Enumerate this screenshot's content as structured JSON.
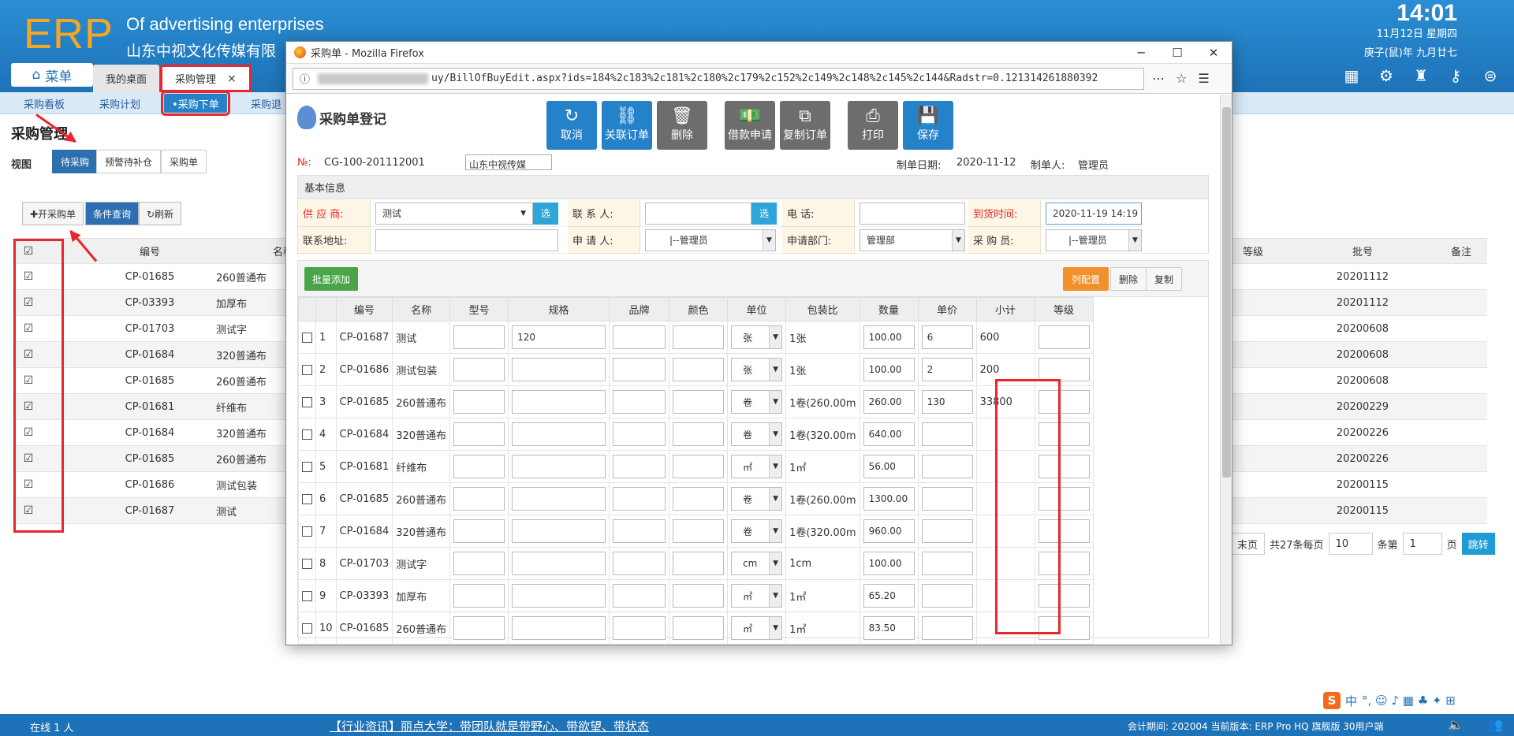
{
  "header": {
    "logo": "ERP",
    "app_en": "Of advertising enterprises",
    "app_cn": "山东中视文化传媒有限",
    "clock": "14:01",
    "date1": "11月12日 星期四",
    "date2": "庚子(鼠)年 九月廿七",
    "menu_label": "菜单",
    "tabs": [
      {
        "label": "我的桌面"
      },
      {
        "label": "采购管理",
        "close": "×"
      }
    ],
    "icons": [
      "grid-icon",
      "gear-icon",
      "shirt-icon",
      "key-icon",
      "collapse-icon"
    ]
  },
  "subnav": {
    "items": [
      "采购看板",
      "采购计划",
      "•采购下单",
      "采购退"
    ]
  },
  "bg": {
    "title": "采购管理",
    "view_label": "视图",
    "views": [
      "待采购",
      "预警待补仓",
      "采购单"
    ],
    "toolbar": [
      "✚开采购单",
      "条件查询",
      "↻刷新"
    ],
    "grid_headers": {
      "code": "编号",
      "name": "名称",
      "level": "等级",
      "batch": "批号",
      "remark": "备注"
    },
    "rows": [
      {
        "code": "CP-01685",
        "name": "260普通布",
        "batch": "20201112"
      },
      {
        "code": "CP-03393",
        "name": "加厚布",
        "batch": "20201112"
      },
      {
        "code": "CP-01703",
        "name": "测试字",
        "batch": "20200608"
      },
      {
        "code": "CP-01684",
        "name": "320普通布",
        "batch": "20200608"
      },
      {
        "code": "CP-01685",
        "name": "260普通布",
        "batch": "20200608"
      },
      {
        "code": "CP-01681",
        "name": "纤维布",
        "batch": "20200229"
      },
      {
        "code": "CP-01684",
        "name": "320普通布",
        "batch": "20200226"
      },
      {
        "code": "CP-01685",
        "name": "260普通布",
        "batch": "20200226"
      },
      {
        "code": "CP-01686",
        "name": "测试包装",
        "batch": "20200115"
      },
      {
        "code": "CP-01687",
        "name": "测试",
        "batch": "20200115"
      }
    ],
    "pager": {
      "last": "末页",
      "total": "共27条每页",
      "per_page": "10",
      "per_unit": "条第",
      "page": "1",
      "page_unit": "页",
      "go": "跳转"
    }
  },
  "statusbar": {
    "online": "在线  1  人",
    "news": "【行业资讯】丽点大学：带团队就是带野心、带欲望、带状态",
    "version": "会计期间: 202004 当前版本: ERP Pro HQ 旗舰版 30用户端"
  },
  "ime": {
    "label": "中",
    "glyphs": "°, ☺ ♪ ▦ ♣ ✦ ⊞"
  },
  "firefox": {
    "title": "采购单 - Mozilla Firefox",
    "url": "uy/BillOfBuyEdit.aspx?ids=184%2c183%2c181%2c180%2c179%2c152%2c149%2c148%2c145%2c144&Radstr=0.121314261880392"
  },
  "form": {
    "title": "采购单登记",
    "buttons": [
      {
        "label": "取消",
        "icon": "↻"
      },
      {
        "label": "关联订单",
        "icon": "⛓"
      },
      {
        "label": "删除",
        "icon": "🗑"
      },
      {
        "label": "借款申请",
        "icon": "💵"
      },
      {
        "label": "复制订单",
        "icon": "⧉"
      },
      {
        "label": "打印",
        "icon": "⎙"
      },
      {
        "label": "保存",
        "icon": "💾"
      }
    ],
    "no_label": "№:",
    "no_value": "CG-100-201112001",
    "company": "山东中视传媒",
    "date_label": "制单日期:",
    "date_value": "2020-11-12",
    "maker_label": "制单人:",
    "maker_value": "管理员",
    "basic_title": "基本信息",
    "supplier_label": "供 应 商:",
    "supplier_value": "测试",
    "pick": "选",
    "contact_label": "联 系 人:",
    "phone_label": "电    话:",
    "arrival_label": "到货时间:",
    "arrival_value": "2020-11-19 14:19",
    "address_label": "联系地址:",
    "applicant_label": "申 请 人:",
    "applicant_value": "|--管理员",
    "dept_label": "申请部门:",
    "dept_value": "管理部",
    "buyer_label": "采 购 员:",
    "buyer_value": "|--管理员",
    "batch_add": "批量添加",
    "col_config": "列配置",
    "delete": "删除",
    "copy": "复制",
    "columns": [
      "",
      "",
      "编号",
      "名称",
      "型号",
      "规格",
      "品牌",
      "颜色",
      "单位",
      "包装比",
      "数量",
      "单价",
      "小计",
      "等级"
    ],
    "lines": [
      {
        "no": "1",
        "code": "CP-01687",
        "name": "测试",
        "spec": "120",
        "unit": "张",
        "pack": "1张",
        "qty": "100.00",
        "price": "6",
        "subtotal": "600"
      },
      {
        "no": "2",
        "code": "CP-01686",
        "name": "测试包装",
        "spec": "",
        "unit": "张",
        "pack": "1张",
        "qty": "100.00",
        "price": "2",
        "subtotal": "200"
      },
      {
        "no": "3",
        "code": "CP-01685",
        "name": "260普通布",
        "spec": "",
        "unit": "卷",
        "pack": "1卷(260.00m",
        "qty": "260.00",
        "price": "130",
        "subtotal": "33800"
      },
      {
        "no": "4",
        "code": "CP-01684",
        "name": "320普通布",
        "spec": "",
        "unit": "卷",
        "pack": "1卷(320.00m",
        "qty": "640.00",
        "price": "",
        "subtotal": ""
      },
      {
        "no": "5",
        "code": "CP-01681",
        "name": "纤维布",
        "spec": "",
        "unit": "㎡",
        "pack": "1㎡",
        "qty": "56.00",
        "price": "",
        "subtotal": ""
      },
      {
        "no": "6",
        "code": "CP-01685",
        "name": "260普通布",
        "spec": "",
        "unit": "卷",
        "pack": "1卷(260.00m",
        "qty": "1300.00",
        "price": "",
        "subtotal": ""
      },
      {
        "no": "7",
        "code": "CP-01684",
        "name": "320普通布",
        "spec": "",
        "unit": "卷",
        "pack": "1卷(320.00m",
        "qty": "960.00",
        "price": "",
        "subtotal": ""
      },
      {
        "no": "8",
        "code": "CP-01703",
        "name": "测试字",
        "spec": "",
        "unit": "cm",
        "pack": "1cm",
        "qty": "100.00",
        "price": "",
        "subtotal": ""
      },
      {
        "no": "9",
        "code": "CP-03393",
        "name": "加厚布",
        "spec": "",
        "unit": "㎡",
        "pack": "1㎡",
        "qty": "65.20",
        "price": "",
        "subtotal": ""
      },
      {
        "no": "10",
        "code": "CP-01685",
        "name": "260普通布",
        "spec": "",
        "unit": "㎡",
        "pack": "1㎡",
        "qty": "83.50",
        "price": "",
        "subtotal": ""
      }
    ]
  }
}
